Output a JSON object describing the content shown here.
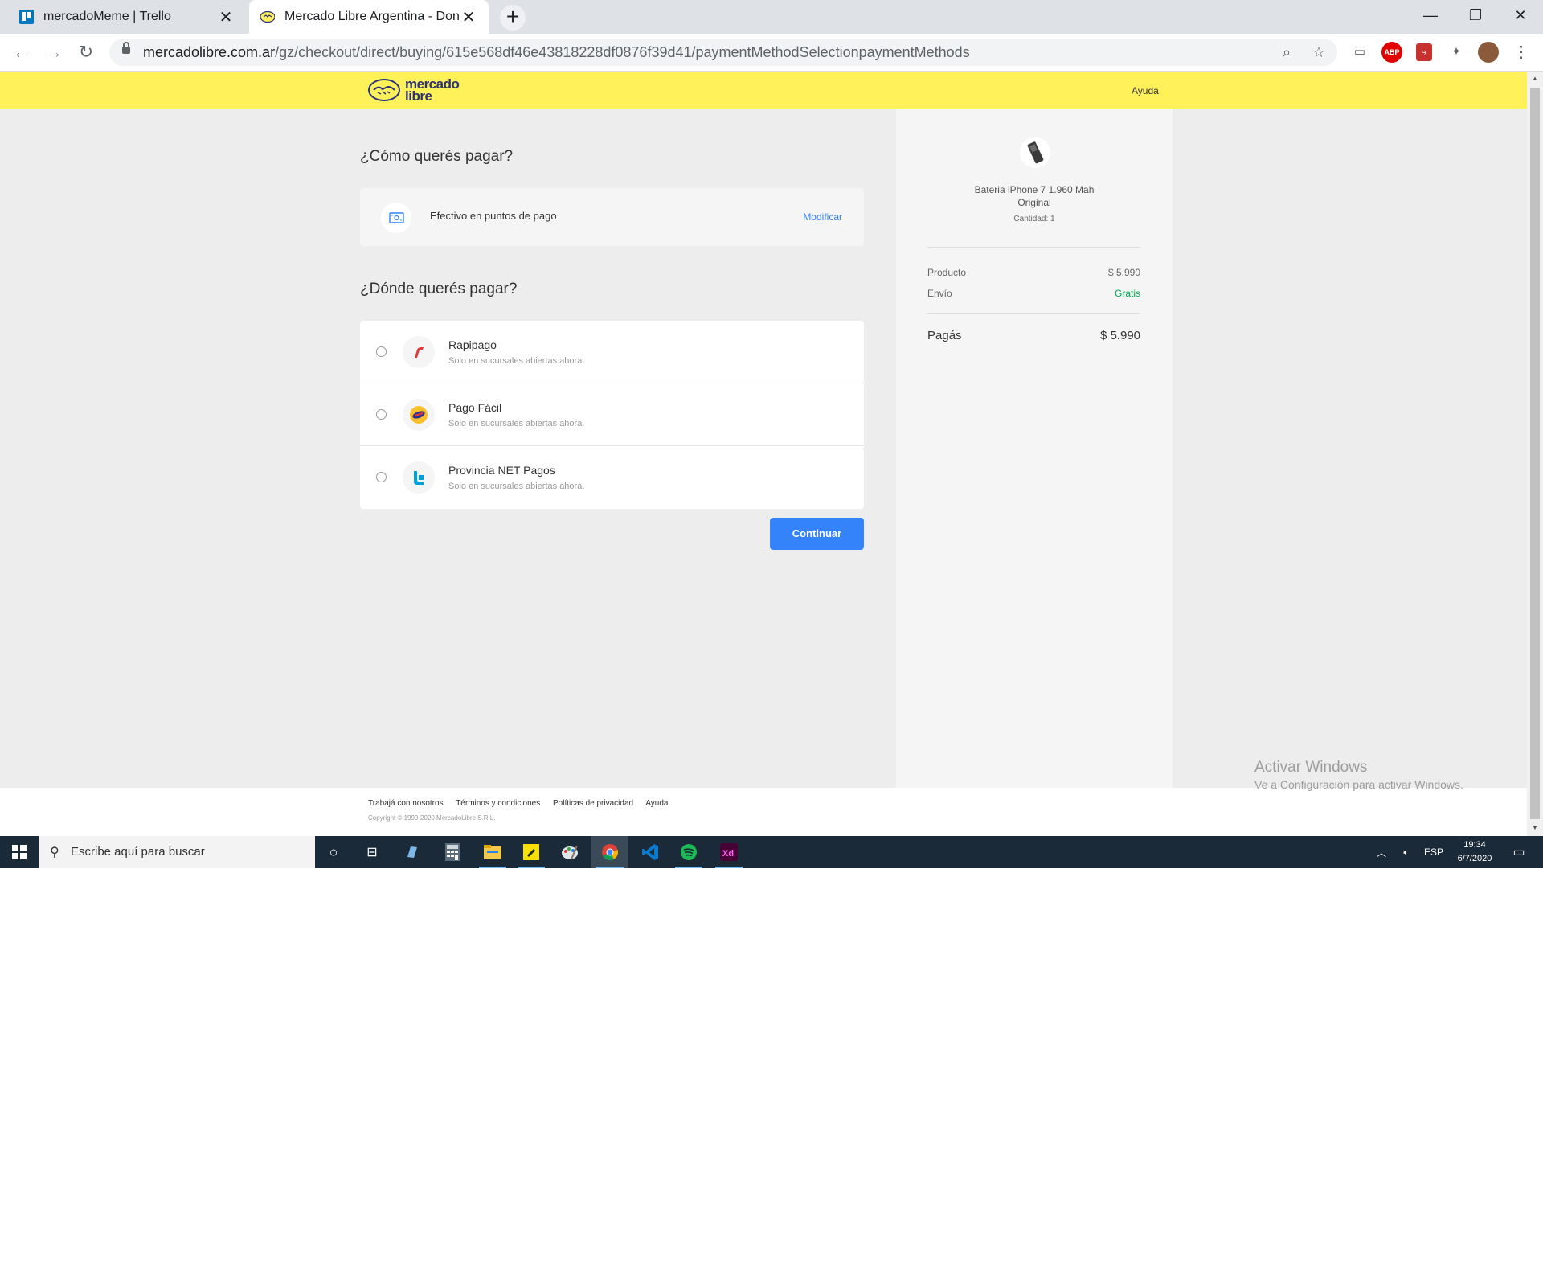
{
  "browser": {
    "tabs": [
      {
        "title": "mercadoMeme | Trello",
        "favicon": "trello-icon"
      },
      {
        "title": "Mercado Libre Argentina - Donde comprar y vender de todo",
        "favicon": "mercadolibre-icon"
      }
    ],
    "url_domain": "mercadolibre.com.ar",
    "url_path": "/gz/checkout/direct/buying/615e568df46e43818228df0876f39d41/paymentMethodSelectionpaymentMethods"
  },
  "site": {
    "logo_line1": "mercado",
    "logo_line2": "libre",
    "help": "Ayuda"
  },
  "checkout": {
    "how_title": "¿Cómo querés pagar?",
    "method_label": "Efectivo en puntos de pago",
    "modify": "Modificar",
    "where_title": "¿Dónde querés pagar?",
    "options": [
      {
        "name": "Rapipago",
        "subtitle": "Solo en sucursales abiertas ahora.",
        "color": "#e53935"
      },
      {
        "name": "Pago Fácil",
        "subtitle": "Solo en sucursales abiertas ahora.",
        "color": "#f9a825"
      },
      {
        "name": "Provincia NET Pagos",
        "subtitle": "Solo en sucursales abiertas ahora.",
        "color": "#00a0df"
      }
    ],
    "continue": "Continuar",
    "accent": "#3483fa"
  },
  "summary": {
    "product_name_1": "Bateria iPhone 7 1.960 Mah",
    "product_name_2": "Original",
    "quantity": "Cantidad: 1",
    "product_label": "Producto",
    "product_value": "$ 5.990",
    "shipping_label": "Envío",
    "shipping_value": "Gratis",
    "total_label": "Pagás",
    "total_value": "$ 5.990"
  },
  "footer": {
    "links": [
      "Trabajá con nosotros",
      "Términos y condiciones",
      "Políticas de privacidad",
      "Ayuda"
    ],
    "copyright": "Copyright © 1999-2020 MercadoLibre S.R.L."
  },
  "watermark": {
    "line1": "Activar Windows",
    "line2": "Ve a Configuración para activar Windows."
  },
  "taskbar": {
    "search_placeholder": "Escribe aquí para buscar",
    "language": "ESP",
    "time": "19:34",
    "date": "6/7/2020"
  }
}
